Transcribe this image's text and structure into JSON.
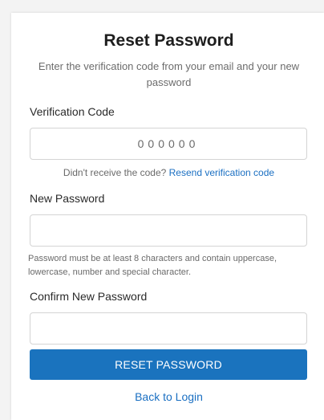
{
  "form": {
    "title": "Reset Password",
    "subtitle": "Enter the verification code from your email and your new password",
    "code_label": "Verification Code",
    "code_placeholder": "000000",
    "code_value": "",
    "resend_text": "Didn't receive the code?",
    "resend_link": "Resend verification code",
    "new_password_label": "New Password",
    "new_password_value": "",
    "password_hint": "Password must be at least 8 characters and contain uppercase, lowercase, number and special character.",
    "confirm_password_label": "Confirm New Password",
    "confirm_password_value": "",
    "submit_label": "RESET PASSWORD",
    "back_link": "Back to Login"
  },
  "colors": {
    "primary": "#1a73be",
    "link": "#1a6fc2",
    "background": "#f3f3f3",
    "card": "#ffffff"
  }
}
